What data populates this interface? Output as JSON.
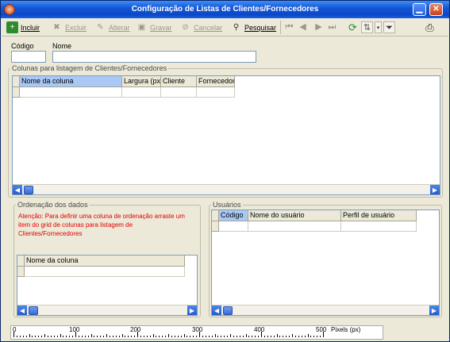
{
  "window": {
    "title": "Configuração de Listas de Clientes/Fornecedores",
    "min_glyph": "▁",
    "close_glyph": "✕"
  },
  "toolbar": {
    "incluir": "Incluir",
    "excluir": "Excluir",
    "alterar": "Alterar",
    "gravar": "Gravar",
    "cancelar": "Cancelar",
    "pesquisar": "Pesquisar",
    "icons": [
      "add-icon",
      "delete-icon",
      "edit-icon",
      "save-icon",
      "cancel-icon",
      "search-icon",
      "first-icon",
      "prev-icon",
      "next-icon",
      "last-icon",
      "refresh-icon",
      "sort-icon",
      "dropdown-icon",
      "filter-icon",
      "print-icon"
    ]
  },
  "form": {
    "codigo_label": "Código",
    "nome_label": "Nome",
    "codigo_value": "",
    "nome_value": ""
  },
  "colunas": {
    "legend": "Colunas para listagem de Clientes/Fornecedores",
    "headers": [
      "Nome da coluna",
      "Largura (px)",
      "Cliente",
      "Fornecedor"
    ]
  },
  "ordenacao": {
    "legend": "Ordenação dos dados",
    "warning": "Atenção: Para definir uma coluna de ordenação arraste um item do grid de colunas para listagem de Clientes/Fornecedores",
    "headers": [
      "Nome da coluna"
    ]
  },
  "usuarios": {
    "legend": "Usuários",
    "headers": [
      "Código",
      "Nome do usuário",
      "Perfil de usuário"
    ]
  },
  "ruler": {
    "labels": [
      "0",
      "100",
      "200",
      "300",
      "400",
      "500"
    ],
    "unit": "Pixels (px)"
  },
  "colors": {
    "warning": "#e00000",
    "selected_header": "#a9c8f5",
    "title_bar": "#0a48c8"
  }
}
